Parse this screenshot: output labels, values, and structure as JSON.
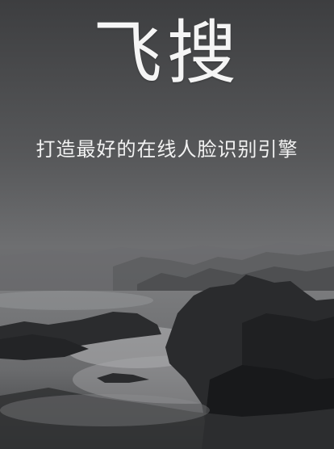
{
  "app": {
    "title": "飞搜",
    "tagline": "打造最好的在线人脸识别引擎"
  },
  "background": {
    "image": "misty-sea-rocks-background"
  }
}
